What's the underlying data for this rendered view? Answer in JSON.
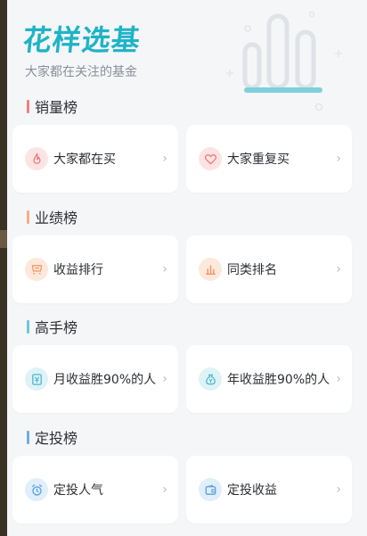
{
  "hero": {
    "title": "花样选基",
    "subtitle": "大家都在关注的基金"
  },
  "sections": [
    {
      "title": "销量榜",
      "color": "#f07f7f",
      "items": [
        {
          "label": "大家都在买",
          "icon": "flame-icon",
          "icon_bg": "#fde4e4",
          "icon_color": "#ee7a7a"
        },
        {
          "label": "大家重复买",
          "icon": "heart-icon",
          "icon_bg": "#fde4e4",
          "icon_color": "#ee7a7a"
        }
      ]
    },
    {
      "title": "业绩榜",
      "color": "#f5ad86",
      "items": [
        {
          "label": "收益排行",
          "icon": "cart-icon",
          "icon_bg": "#fde8dc",
          "icon_color": "#f19a6b"
        },
        {
          "label": "同类排名",
          "icon": "bar-chart-icon",
          "icon_bg": "#fde8dc",
          "icon_color": "#f19a6b"
        }
      ]
    },
    {
      "title": "高手榜",
      "color": "#6ec7d9",
      "items": [
        {
          "label": "月收益胜90%的人",
          "icon": "calendar-yen-icon",
          "icon_bg": "#dff3f7",
          "icon_color": "#4bb8cc"
        },
        {
          "label": "年收益胜90%的人",
          "icon": "money-bag-icon",
          "icon_bg": "#dff3f7",
          "icon_color": "#4bb8cc"
        }
      ]
    },
    {
      "title": "定投榜",
      "color": "#6aaee6",
      "items": [
        {
          "label": "定投人气",
          "icon": "alarm-clock-icon",
          "icon_bg": "#e1eefb",
          "icon_color": "#5aa2e0"
        },
        {
          "label": "定投收益",
          "icon": "wallet-icon",
          "icon_bg": "#e1eefb",
          "icon_color": "#5aa2e0"
        }
      ]
    }
  ]
}
